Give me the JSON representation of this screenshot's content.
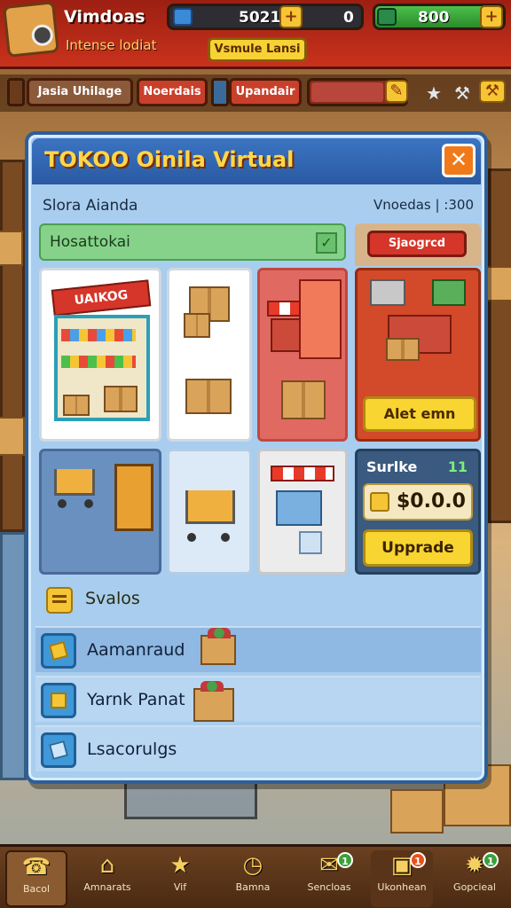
{
  "app": {
    "title": "Vimdoas",
    "subtitle": "Intense lodiat"
  },
  "resources": {
    "coins_value": "5021",
    "coins_extra": "0",
    "gems_value": "800",
    "banner": "Vsmule Lansi"
  },
  "toolbar": {
    "btn1_label": "Jasia Uhilage",
    "btn2_label": "Noerdais",
    "btn3_label": "Upandair",
    "meter_fill": 0.78
  },
  "modal": {
    "title": "TOKOO Oinila Virtual",
    "store_label": "Slora Aianda",
    "currency_info": "Vnoedas | :300",
    "search_text": "Hosattokai",
    "special_btn": "Sjaogrcd",
    "featured_btn": "Alet emn",
    "stats_label": "Surlke",
    "stats_count": "11",
    "price_text": "$0.0.0",
    "upgrade_btn": "Upprade",
    "grid_sign": "UAIKOG",
    "section_title": "Svalos",
    "list": [
      {
        "label": "Aamanraud"
      },
      {
        "label": "Yarnk Panat"
      },
      {
        "label": "Lsacorulgs"
      }
    ]
  },
  "nav": [
    {
      "label": "Bacol",
      "icon": "phone-icon"
    },
    {
      "label": "Amnarats",
      "icon": "house-icon"
    },
    {
      "label": "Vif",
      "icon": "star-icon"
    },
    {
      "label": "Bamna",
      "icon": "clock-icon"
    },
    {
      "label": "Sencloas",
      "icon": "chat-icon",
      "badge": "1"
    },
    {
      "label": "Ukonhean",
      "icon": "bag-icon",
      "badge": "1"
    },
    {
      "label": "Gopcieal",
      "icon": "sparkle-icon",
      "badge": "1"
    }
  ],
  "colors": {
    "header_red": "#c9321c",
    "modal_blue": "#a8cdee",
    "accent_yellow": "#f8d530"
  }
}
